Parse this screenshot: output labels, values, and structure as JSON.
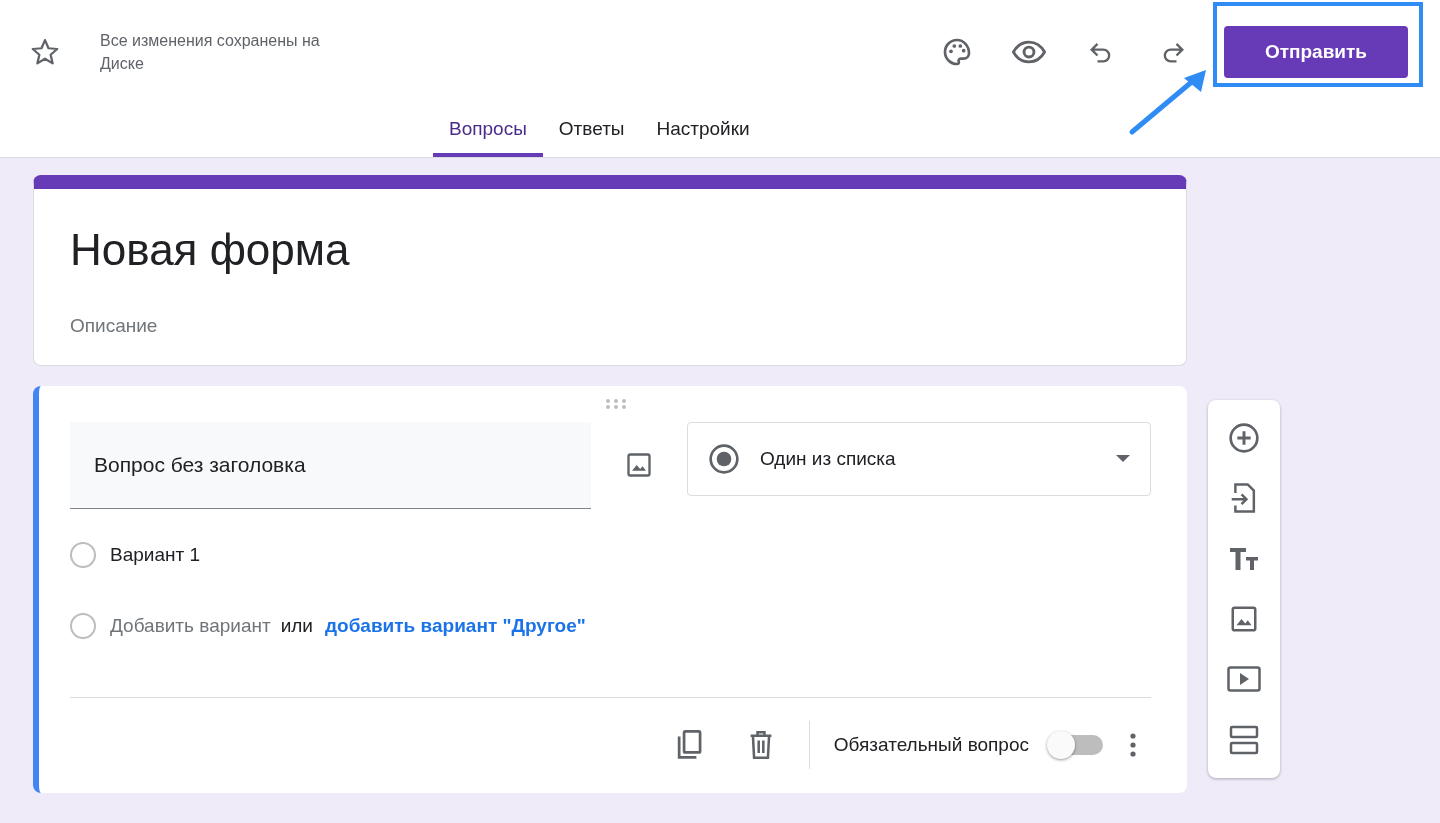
{
  "header": {
    "starred": false,
    "status": "Все изменения сохранены на Диске",
    "send_button": "Отправить"
  },
  "tabs": [
    {
      "label": "Вопросы",
      "selected": true
    },
    {
      "label": "Ответы",
      "selected": false
    },
    {
      "label": "Настройки",
      "selected": false
    }
  ],
  "form": {
    "title": "Новая форма",
    "description_placeholder": "Описание"
  },
  "question": {
    "title": "Вопрос без заголовка",
    "type": "Один из списка",
    "options": [
      {
        "label": "Вариант 1"
      }
    ],
    "add_option": {
      "placeholder": "Добавить вариант",
      "or": "или",
      "other_link": "добавить вариант \"Другое\""
    },
    "required": {
      "label": "Обязательный вопрос",
      "on": false
    }
  }
}
